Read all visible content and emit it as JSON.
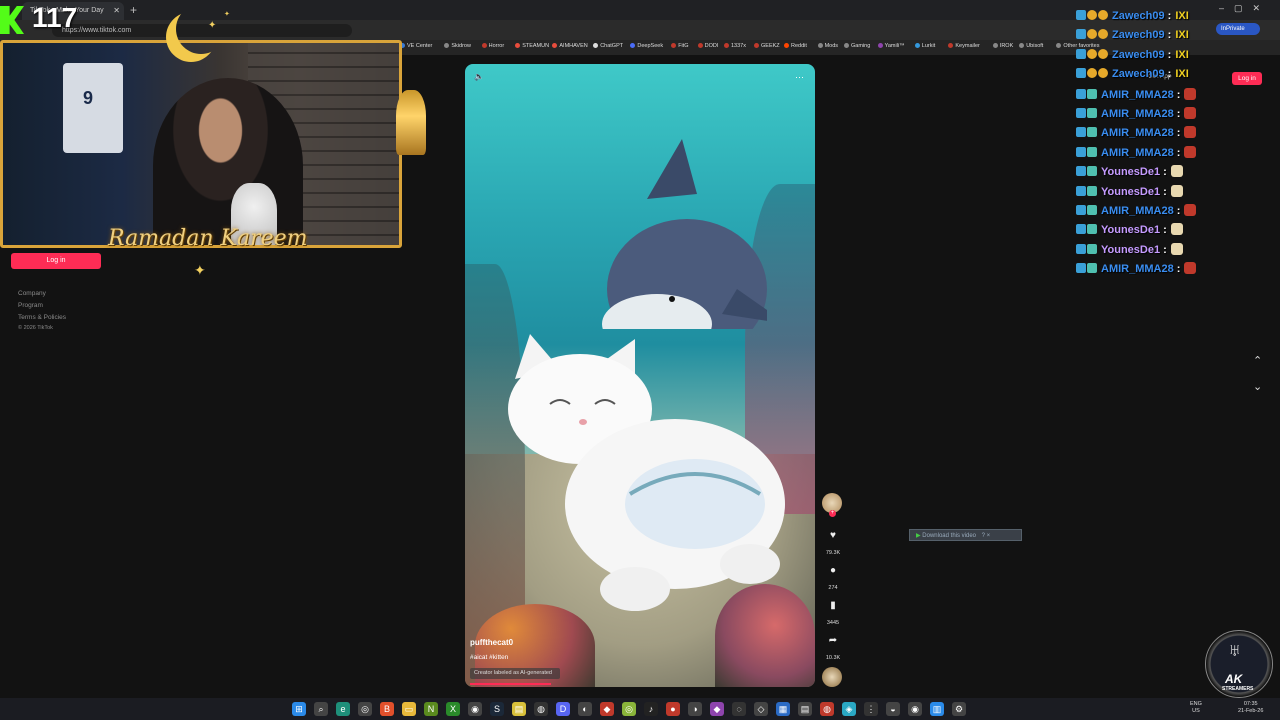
{
  "browser": {
    "tab_title": "TikTok - Make Your Day",
    "url": "https://www.tiktok.com",
    "inprivate_label": "InPrivate",
    "favorites": [
      {
        "label": "VE Center",
        "color": "#3a7bd5"
      },
      {
        "label": "Skidrow",
        "color": "#888888"
      },
      {
        "label": "Horror",
        "color": "#c0392b"
      },
      {
        "label": "STEAMUN",
        "color": "#e74c3c"
      },
      {
        "label": "AIMHAVEN",
        "color": "#e74c3c"
      },
      {
        "label": "ChatGPT",
        "color": "#dddddd"
      },
      {
        "label": "DeepSeek",
        "color": "#4a6cf7"
      },
      {
        "label": "FitG",
        "color": "#c0392b"
      },
      {
        "label": "DODI",
        "color": "#c0392b"
      },
      {
        "label": "1337x",
        "color": "#c0392b"
      },
      {
        "label": "GEEKZ",
        "color": "#c0392b"
      },
      {
        "label": "Reddit",
        "color": "#ff4500"
      },
      {
        "label": "Mods",
        "color": "#888888"
      },
      {
        "label": "Gaming",
        "color": "#888888"
      },
      {
        "label": "Yamili™",
        "color": "#8e44ad"
      },
      {
        "label": "Lurkit",
        "color": "#3498db"
      },
      {
        "label": "Keymailer",
        "color": "#c0392b"
      },
      {
        "label": "IROK",
        "color": "#888888"
      },
      {
        "label": "Ubisoft",
        "color": "#888888"
      },
      {
        "label": "Other favorites",
        "color": "#888888"
      }
    ]
  },
  "tiktok": {
    "sidebar_login": "Log in",
    "top_login": "Log in",
    "get_app": "Get App",
    "footer": [
      "Company",
      "Program",
      "Terms & Policies",
      "© 2026 TikTok"
    ],
    "video": {
      "author": "puffthecat0",
      "tags": "#aicat #kitten",
      "ai_label": "Creator labeled as AI-generated",
      "progress": 0.23
    },
    "actions": [
      {
        "icon": "heart-icon",
        "glyph": "♥",
        "count": "79.3K"
      },
      {
        "icon": "comment-icon",
        "glyph": "●",
        "count": "274"
      },
      {
        "icon": "bookmark-icon",
        "glyph": "▮",
        "count": "3445"
      },
      {
        "icon": "share-icon",
        "glyph": "➦",
        "count": "10.3K"
      }
    ],
    "follow_plus": "+",
    "download_bar": "Download this video",
    "download_close": "? ×"
  },
  "stream": {
    "viewer_count": "117",
    "ramadan_text": "Ramadan Kareem",
    "jersey_number": "9",
    "ak_title": "AK",
    "ak_sub": "STREAMERS",
    "chat": [
      {
        "user": "Zawech09",
        "sep": ":",
        "msg": "IXI",
        "color": "#3a8df0",
        "msgcolor": "#f0d020"
      },
      {
        "user": "Zawech09",
        "sep": ":",
        "msg": "IXI",
        "color": "#3a8df0",
        "msgcolor": "#f0d020"
      },
      {
        "user": "Zawech09",
        "sep": ":",
        "msg": "IXI",
        "color": "#3a8df0",
        "msgcolor": "#f0d020"
      },
      {
        "user": "Zawech09",
        "sep": ":",
        "msg": "IXI",
        "color": "#3a8df0",
        "msgcolor": "#f0d020"
      },
      {
        "user": "AMIR_MMA28",
        "sep": ":",
        "msg": "",
        "color": "#3a8df0",
        "msgcolor": "#c0392b"
      },
      {
        "user": "AMIR_MMA28",
        "sep": ":",
        "msg": "",
        "color": "#3a8df0",
        "msgcolor": "#c0392b"
      },
      {
        "user": "AMIR_MMA28",
        "sep": ":",
        "msg": "",
        "color": "#3a8df0",
        "msgcolor": "#c0392b"
      },
      {
        "user": "AMIR_MMA28",
        "sep": ":",
        "msg": "",
        "color": "#3a8df0",
        "msgcolor": "#c0392b"
      },
      {
        "user": "YounesDe1",
        "sep": ":",
        "msg": "",
        "color": "#c59bff",
        "msgcolor": "#e8d8b0"
      },
      {
        "user": "YounesDe1",
        "sep": ":",
        "msg": "",
        "color": "#c59bff",
        "msgcolor": "#e8d8b0"
      },
      {
        "user": "AMIR_MMA28",
        "sep": ":",
        "msg": "",
        "color": "#3a8df0",
        "msgcolor": "#c0392b"
      },
      {
        "user": "YounesDe1",
        "sep": ":",
        "msg": "",
        "color": "#c59bff",
        "msgcolor": "#e8d8b0"
      },
      {
        "user": "YounesDe1",
        "sep": ":",
        "msg": "",
        "color": "#c59bff",
        "msgcolor": "#e8d8b0"
      },
      {
        "user": "AMIR_MMA28",
        "sep": ":",
        "msg": "",
        "color": "#3a8df0",
        "msgcolor": "#c0392b"
      }
    ]
  },
  "taskbar": {
    "icons": [
      {
        "name": "start-icon",
        "glyph": "⊞",
        "color": "#2b8ae8"
      },
      {
        "name": "search-icon",
        "glyph": "⌕",
        "color": "#444"
      },
      {
        "name": "edge-icon",
        "glyph": "e",
        "color": "#1e8f7a"
      },
      {
        "name": "chrome-icon",
        "glyph": "◎",
        "color": "#444"
      },
      {
        "name": "brave-icon",
        "glyph": "B",
        "color": "#e2502b"
      },
      {
        "name": "explorer-icon",
        "glyph": "▭",
        "color": "#e8b83a"
      },
      {
        "name": "nvidia-icon",
        "glyph": "N",
        "color": "#5a8a1e"
      },
      {
        "name": "xbox-icon",
        "glyph": "X",
        "color": "#2a8a2a"
      },
      {
        "name": "app-icon",
        "glyph": "◉",
        "color": "#444"
      },
      {
        "name": "steam-icon",
        "glyph": "S",
        "color": "#1b2838"
      },
      {
        "name": "folder-icon",
        "glyph": "▤",
        "color": "#d8c03a"
      },
      {
        "name": "obs-icon",
        "glyph": "◍",
        "color": "#333"
      },
      {
        "name": "discord-icon",
        "glyph": "D",
        "color": "#5865f2"
      },
      {
        "name": "app2-icon",
        "glyph": "◐",
        "color": "#444"
      },
      {
        "name": "app3-icon",
        "glyph": "◆",
        "color": "#c0392b"
      },
      {
        "name": "app4-icon",
        "glyph": "◎",
        "color": "#8ab43a"
      },
      {
        "name": "tiktok-icon",
        "glyph": "♪",
        "color": "#222"
      },
      {
        "name": "app5-icon",
        "glyph": "●",
        "color": "#c0392b"
      },
      {
        "name": "app6-icon",
        "glyph": "◑",
        "color": "#444"
      },
      {
        "name": "app7-icon",
        "glyph": "◆",
        "color": "#8e44ad"
      },
      {
        "name": "app8-icon",
        "glyph": "◌",
        "color": "#333"
      },
      {
        "name": "app9-icon",
        "glyph": "◇",
        "color": "#444"
      },
      {
        "name": "app10-icon",
        "glyph": "▦",
        "color": "#2a6ac4"
      },
      {
        "name": "app11-icon",
        "glyph": "▤",
        "color": "#444"
      },
      {
        "name": "app12-icon",
        "glyph": "◍",
        "color": "#c0392b"
      },
      {
        "name": "app13-icon",
        "glyph": "◈",
        "color": "#2aa8c4"
      },
      {
        "name": "app14-icon",
        "glyph": "⋮",
        "color": "#333"
      },
      {
        "name": "app15-icon",
        "glyph": "◒",
        "color": "#444"
      },
      {
        "name": "app16-icon",
        "glyph": "◉",
        "color": "#444"
      },
      {
        "name": "notepad-icon",
        "glyph": "▥",
        "color": "#2a8ae8"
      },
      {
        "name": "settings-icon",
        "glyph": "⚙",
        "color": "#444"
      }
    ],
    "lang": "ENG",
    "region": "US",
    "time": "07:35",
    "date": "21-Feb-26"
  }
}
